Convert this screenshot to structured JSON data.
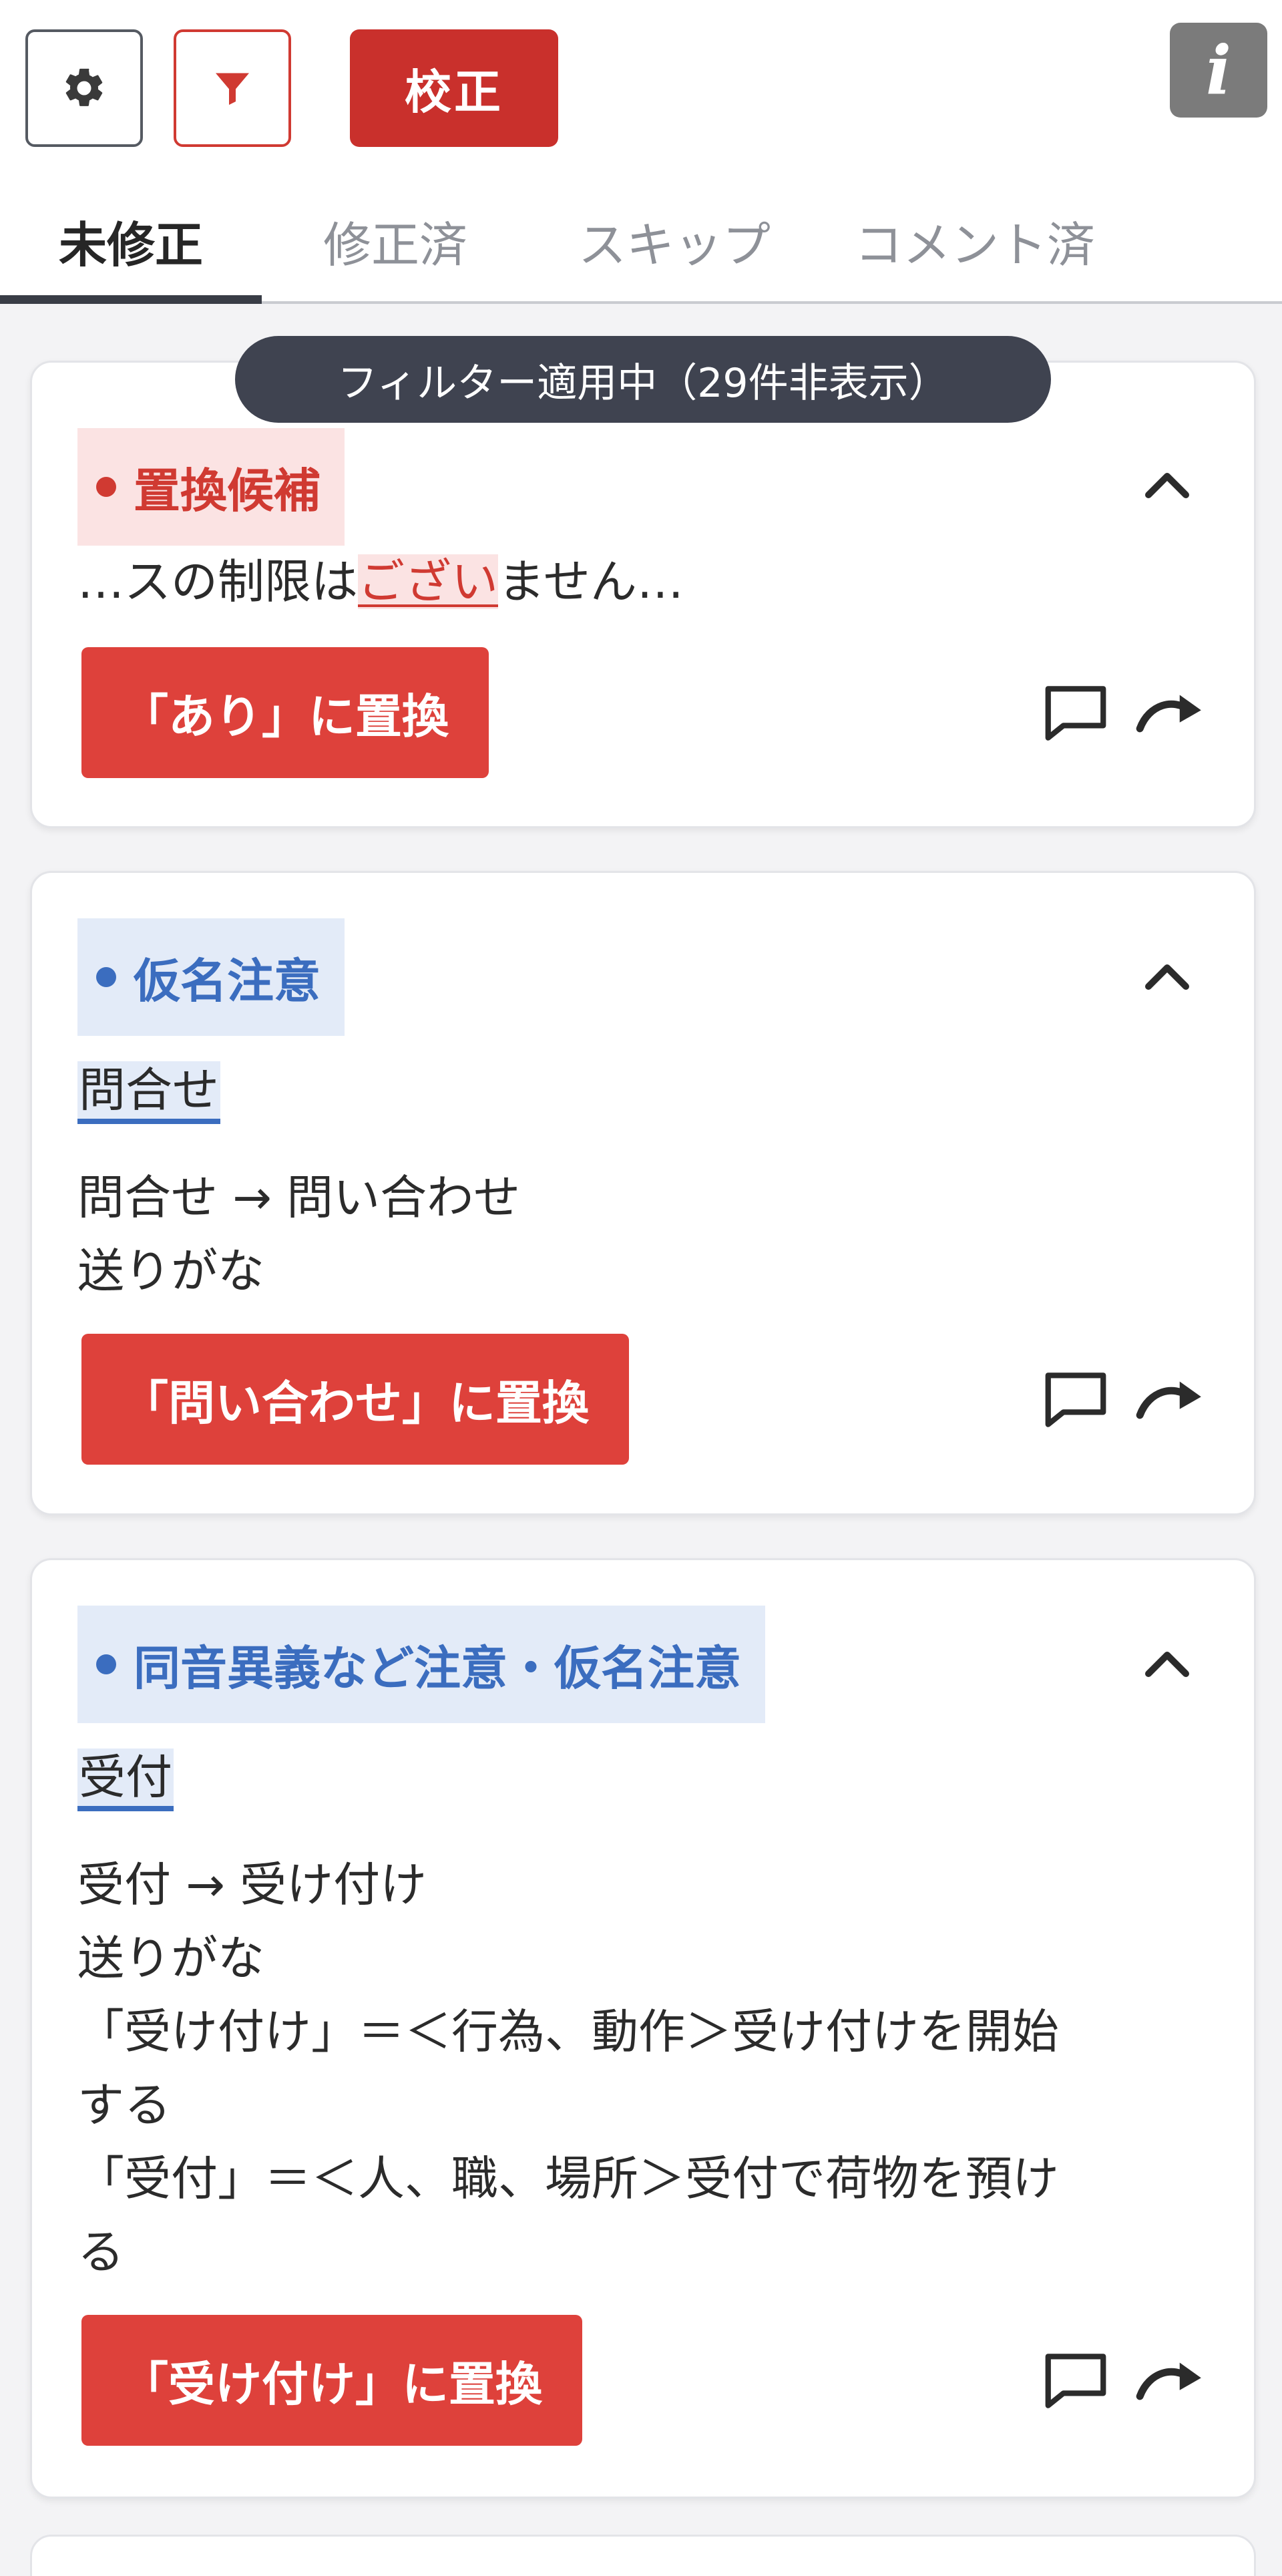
{
  "header": {
    "proof_label": "校正",
    "info_label": "i"
  },
  "tabs": [
    {
      "label": "未修正",
      "active": true
    },
    {
      "label": "修正済",
      "active": false
    },
    {
      "label": "スキップ",
      "active": false
    },
    {
      "label": "コメント済",
      "active": false
    }
  ],
  "filter_banner": "フィルター適用中（29件非表示）",
  "cards": [
    {
      "tag": "置換候補",
      "tag_color": "#d03a32",
      "context_before": "…スの制限は",
      "context_highlight": "ござい",
      "context_after": "ません…",
      "replace_label": "「あり」に置換"
    },
    {
      "tag": "仮名注意",
      "tag_color": "#3b6dbf",
      "word": "問合せ",
      "lines": [
        "問合せ → 問い合わせ",
        "送りがな"
      ],
      "replace_label": "「問い合わせ」に置換"
    },
    {
      "tag": "同音異義など注意・仮名注意",
      "tag_color": "#3b6dbf",
      "word": "受付",
      "lines": [
        "受付 → 受け付け",
        "送りがな",
        "「受け付け」＝＜行為、動作＞受け付けを開始",
        "する",
        "「受付」＝＜人、職、場所＞受付で荷物を預け",
        "る"
      ],
      "replace_label": "「受け付け」に置換"
    }
  ],
  "colors": {
    "accent_red": "#de413b",
    "dark_red": "#c9302c",
    "blue": "#3b6dbf"
  }
}
